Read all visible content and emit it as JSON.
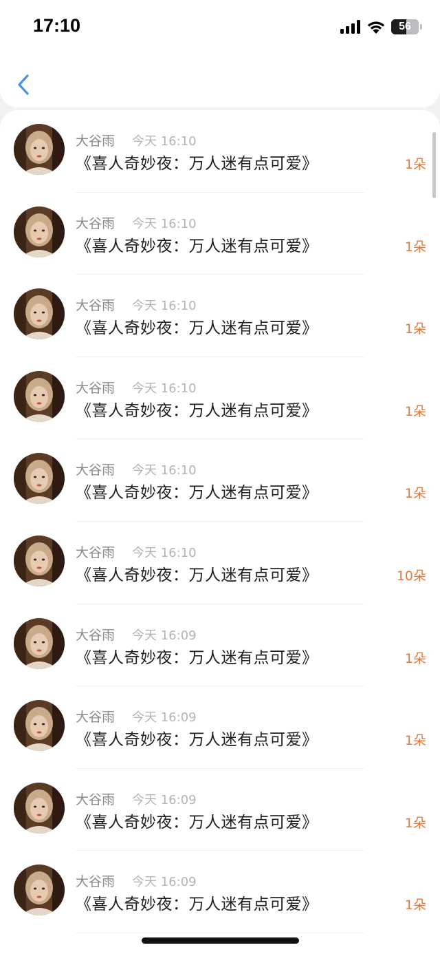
{
  "status_bar": {
    "time": "17:10",
    "battery": "56",
    "battery_fraction": 0.56,
    "icons": [
      "cellular-signal-icon",
      "wifi-icon",
      "battery-icon"
    ]
  },
  "nav": {
    "back_icon": "chevron-left-icon",
    "accent_color": "#4a90e2"
  },
  "colors": {
    "amount": "#e07a3b",
    "name": "#8a8a8e",
    "time": "#b3b3b8"
  },
  "items": [
    {
      "name": "大谷雨",
      "time": "今天 16:10",
      "title": "《喜人奇妙夜：万人迷有点可爱》",
      "amount": "1朵"
    },
    {
      "name": "大谷雨",
      "time": "今天 16:10",
      "title": "《喜人奇妙夜：万人迷有点可爱》",
      "amount": "1朵"
    },
    {
      "name": "大谷雨",
      "time": "今天 16:10",
      "title": "《喜人奇妙夜：万人迷有点可爱》",
      "amount": "1朵"
    },
    {
      "name": "大谷雨",
      "time": "今天 16:10",
      "title": "《喜人奇妙夜：万人迷有点可爱》",
      "amount": "1朵"
    },
    {
      "name": "大谷雨",
      "time": "今天 16:10",
      "title": "《喜人奇妙夜：万人迷有点可爱》",
      "amount": "1朵"
    },
    {
      "name": "大谷雨",
      "time": "今天 16:10",
      "title": "《喜人奇妙夜：万人迷有点可爱》",
      "amount": "10朵"
    },
    {
      "name": "大谷雨",
      "time": "今天 16:09",
      "title": "《喜人奇妙夜：万人迷有点可爱》",
      "amount": "1朵"
    },
    {
      "name": "大谷雨",
      "time": "今天 16:09",
      "title": "《喜人奇妙夜：万人迷有点可爱》",
      "amount": "1朵"
    },
    {
      "name": "大谷雨",
      "time": "今天 16:09",
      "title": "《喜人奇妙夜：万人迷有点可爱》",
      "amount": "1朵"
    },
    {
      "name": "大谷雨",
      "time": "今天 16:09",
      "title": "《喜人奇妙夜：万人迷有点可爱》",
      "amount": "1朵"
    }
  ]
}
